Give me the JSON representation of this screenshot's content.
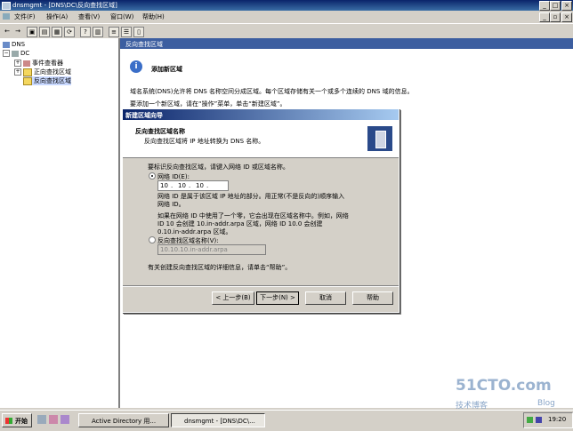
{
  "window": {
    "title": "dnsmgmt - [DNS\\DC\\反向查找区域]",
    "controls": {
      "minimize": "_",
      "maximize": "□",
      "close": "×"
    }
  },
  "menubar": {
    "items": [
      "文件(F)",
      "操作(A)",
      "查看(V)",
      "窗口(W)",
      "帮助(H)"
    ],
    "doc_controls": {
      "minimize": "_",
      "restore": "▫",
      "close": "×"
    }
  },
  "tree": {
    "root": "DNS",
    "server": "DC",
    "children": [
      "事件查看器",
      "正向查找区域",
      "反向查找区域"
    ]
  },
  "right_pane": {
    "header": "反向查找区域",
    "heading": "添加新区域",
    "desc": "域名系统(DNS)允许将 DNS 名称空间分成区域。每个区域存储有关一个或多个连续的 DNS 域的信息。",
    "hint": "要添加一个新区域，请在“操作”菜单，单击“新建区域”。"
  },
  "dialog": {
    "title": "新建区域向导",
    "head_title": "反向查找区域名称",
    "head_sub": "反向查找区域将 IP 地址转换为 DNS 名称。",
    "instruction": "要标识反向查找区域，请键入网络 ID 或区域名称。",
    "radio_net_label": "网络 ID(E):",
    "net_id": [
      "10",
      "10",
      "10",
      ""
    ],
    "net_note_1": "网络 ID 是属于该区域 IP 地址的部分。用正常(不是反向的)顺序输入",
    "net_note_2": "网络 ID。",
    "zero_note_1": "如果在网络 ID 中使用了一个零，它会出现在区域名称中。例如，网络",
    "zero_note_2": "ID 10 会创建 10.in-addr.arpa 区域，网络 ID 10.0 会创建",
    "zero_note_3": "0.10.in-addr.arpa 区域。",
    "radio_zone_label": "反向查找区域名称(V):",
    "zone_name": "10.10.10.in-addr.arpa",
    "help_text": "有关创建反向查找区域的详细信息，请单击“帮助”。",
    "buttons": {
      "back": "< 上一步(B)",
      "next": "下一步(N) >",
      "cancel": "取消",
      "help": "帮助"
    }
  },
  "taskbar": {
    "start": "开始",
    "tasks": [
      "Active Directory 用...",
      "dnsmgmt - [DNS\\DC\\..."
    ],
    "clock": "19:20"
  },
  "watermark": {
    "site": "51CTO.com",
    "blog": "技术博客",
    "blog_en": "Blog"
  }
}
